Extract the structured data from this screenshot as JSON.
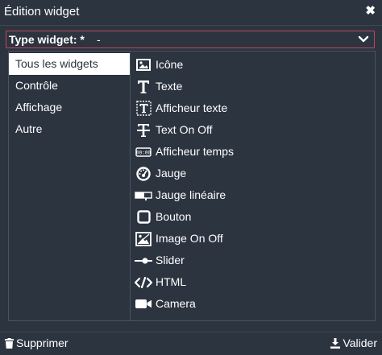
{
  "dialog": {
    "title": "Édition widget",
    "close_icon": "close-icon"
  },
  "type_select": {
    "label": "Type widget: *",
    "value": "-"
  },
  "categories": [
    {
      "label": "Tous les widgets",
      "active": true
    },
    {
      "label": "Contrôle",
      "active": false
    },
    {
      "label": "Affichage",
      "active": false
    },
    {
      "label": "Autre",
      "active": false
    }
  ],
  "widgets": [
    {
      "label": "Icône",
      "icon": "image-icon"
    },
    {
      "label": "Texte",
      "icon": "text-icon"
    },
    {
      "label": "Afficheur texte",
      "icon": "text-display-icon"
    },
    {
      "label": "Text On Off",
      "icon": "text-on-off-icon"
    },
    {
      "label": "Afficheur temps",
      "icon": "time-display-icon"
    },
    {
      "label": "Jauge",
      "icon": "gauge-icon"
    },
    {
      "label": "Jauge linéaire",
      "icon": "linear-gauge-icon"
    },
    {
      "label": "Bouton",
      "icon": "button-icon"
    },
    {
      "label": "Image On Off",
      "icon": "image-on-off-icon"
    },
    {
      "label": "Slider",
      "icon": "slider-icon"
    },
    {
      "label": "HTML",
      "icon": "code-icon"
    },
    {
      "label": "Camera",
      "icon": "camera-icon"
    }
  ],
  "footer": {
    "delete_label": "Supprimer",
    "validate_label": "Valider"
  },
  "colors": {
    "background": "#2c3440",
    "select_border": "#c0475a",
    "active_category_bg": "#ffffff",
    "text": "#ffffff"
  }
}
